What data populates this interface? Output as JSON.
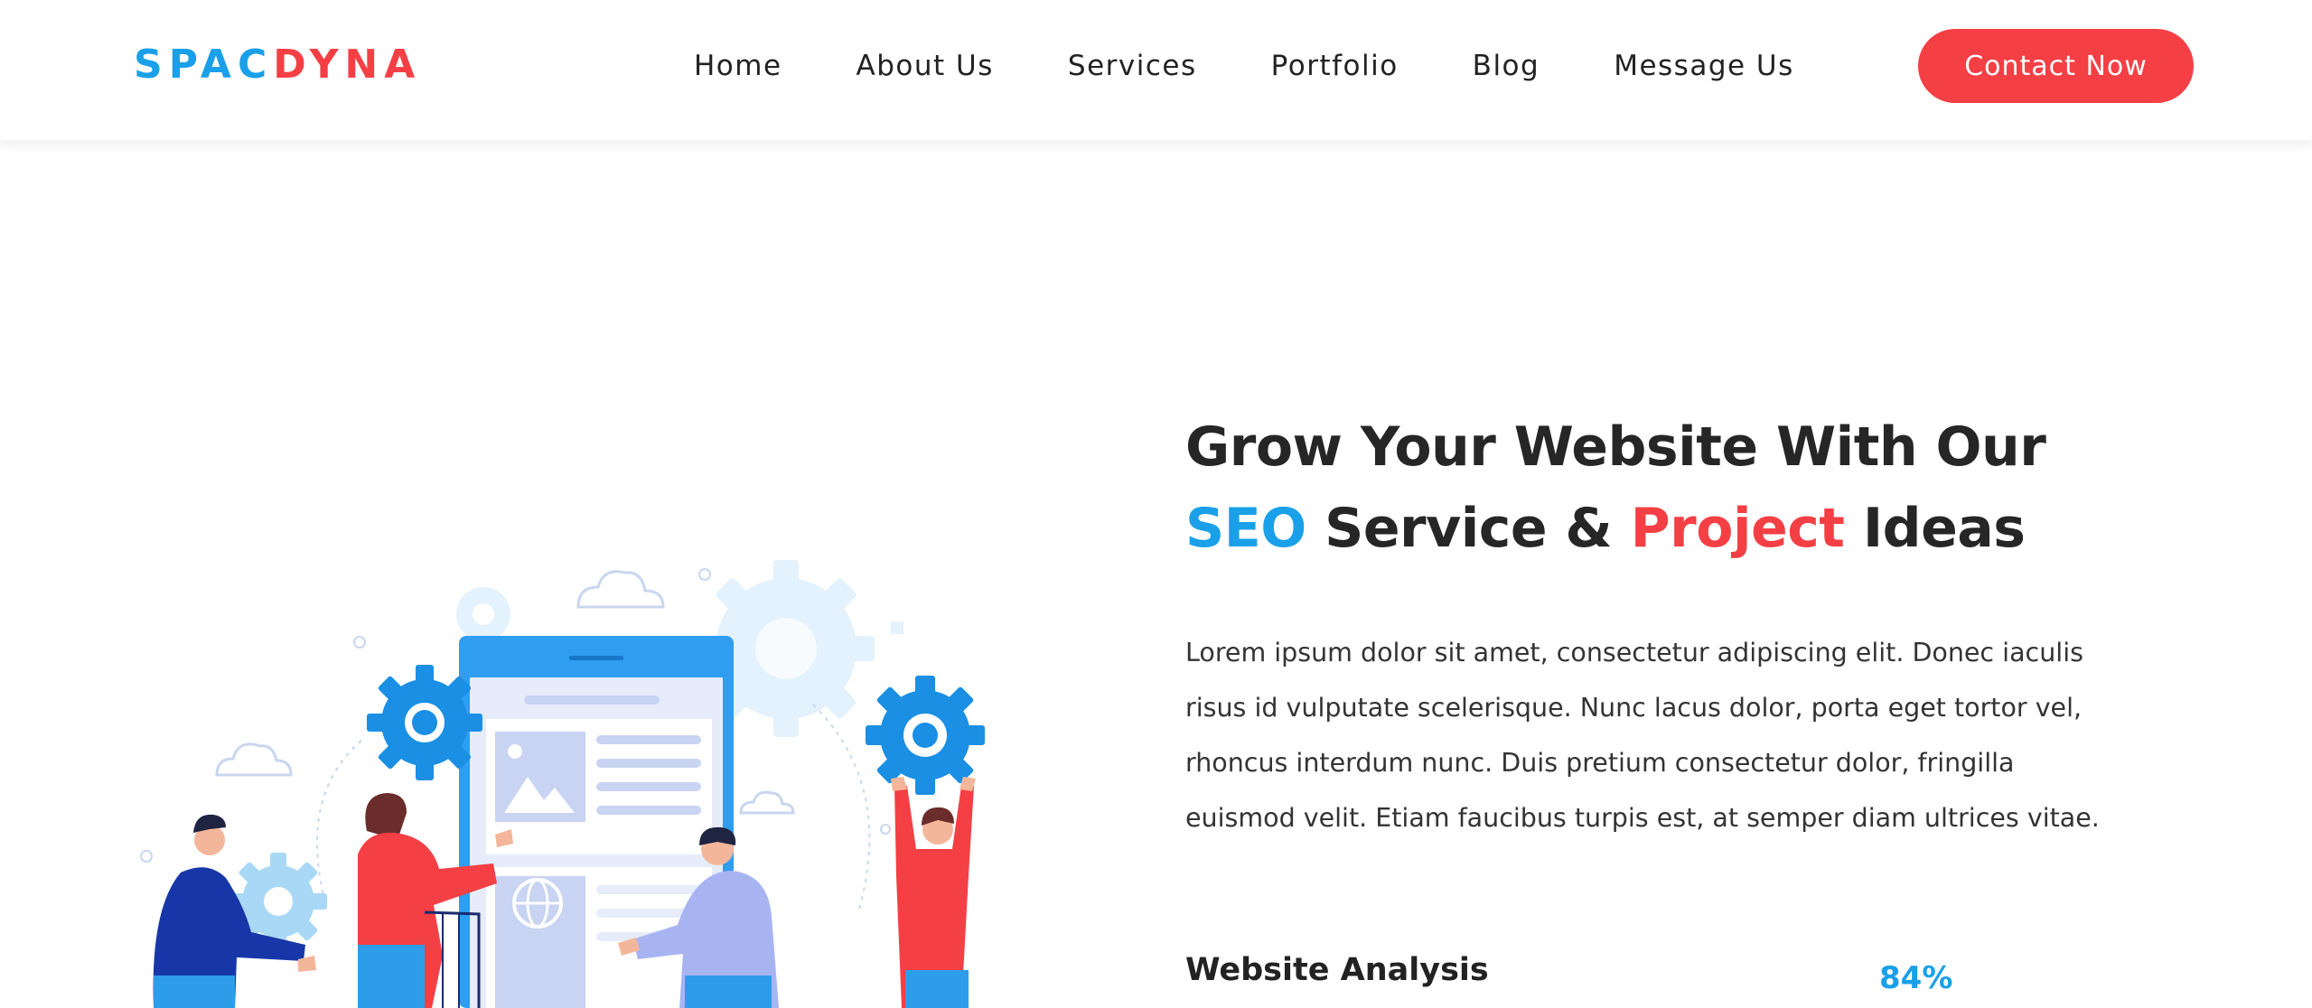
{
  "brand": {
    "part1": "SPAC",
    "part2": "DYNA"
  },
  "nav": {
    "items": [
      {
        "label": "Home"
      },
      {
        "label": "About Us"
      },
      {
        "label": "Services"
      },
      {
        "label": "Portfolio"
      },
      {
        "label": "Blog"
      },
      {
        "label": "Message Us"
      }
    ],
    "cta_label": "Contact Now"
  },
  "hero": {
    "title_line1": "Grow Your Website With Our",
    "title_seo": "SEO",
    "title_mid": " Service & ",
    "title_project": "Project",
    "title_end": " Ideas",
    "body_lines": [
      "Lorem ipsum dolor sit amet, consectetur adipiscing elit. Donec iaculis",
      "risus id vulputate scelerisque. Nunc lacus dolor, porta eget tortor vel,",
      "rhoncus interdum nunc. Duis pretium consectetur dolor, fringilla",
      "euismod velit. Etiam faucibus turpis est, at semper diam ultrices vitae."
    ]
  },
  "skills": [
    {
      "label": "Website Analysis",
      "value": "84%"
    }
  ],
  "colors": {
    "brand_blue": "#1aa0e8",
    "brand_red": "#f43f45",
    "text_dark": "#262626"
  },
  "icons": {
    "illustration": "seo-team-illustration"
  }
}
